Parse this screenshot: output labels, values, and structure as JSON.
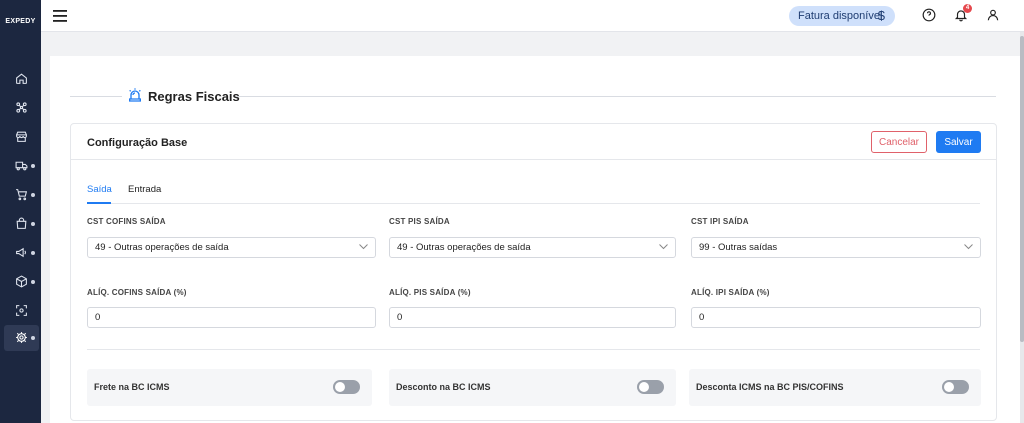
{
  "app": {
    "logo": "EXPEDY"
  },
  "sidebar": {
    "items": [
      {
        "name": "home",
        "icon": "home-icon",
        "has_dot": false
      },
      {
        "name": "integrations",
        "icon": "network-icon",
        "has_dot": false
      },
      {
        "name": "store",
        "icon": "store-icon",
        "has_dot": false
      },
      {
        "name": "shipping",
        "icon": "truck-icon",
        "has_dot": true
      },
      {
        "name": "cart",
        "icon": "cart-icon",
        "has_dot": true
      },
      {
        "name": "bag",
        "icon": "bag-icon",
        "has_dot": true
      },
      {
        "name": "marketing",
        "icon": "megaphone-icon",
        "has_dot": true
      },
      {
        "name": "products",
        "icon": "box-icon",
        "has_dot": true
      },
      {
        "name": "scan",
        "icon": "scan-icon",
        "has_dot": false
      },
      {
        "name": "settings",
        "icon": "gear-icon",
        "has_dot": true,
        "active": true
      }
    ]
  },
  "topbar": {
    "fatura_label": "Fatura disponível",
    "fatura_symbol": "$",
    "notification_count": "4"
  },
  "page": {
    "title": "Regras Fiscais"
  },
  "card": {
    "title": "Configuração Base",
    "cancel_label": "Cancelar",
    "save_label": "Salvar",
    "tabs": [
      {
        "label": "Saída",
        "active": true
      },
      {
        "label": "Entrada",
        "active": false
      }
    ],
    "selects": [
      {
        "label": "CST COFINS SAÍDA",
        "value": "49 - Outras operações de saída"
      },
      {
        "label": "CST PIS SAÍDA",
        "value": "49 - Outras operações de saída"
      },
      {
        "label": "CST IPI SAÍDA",
        "value": "99 - Outras saídas"
      }
    ],
    "inputs": [
      {
        "label": "ALÍQ. COFINS SAÍDA (%)",
        "value": "0"
      },
      {
        "label": "ALÍQ. PIS SAÍDA (%)",
        "value": "0"
      },
      {
        "label": "ALÍQ. IPI SAÍDA (%)",
        "value": "0"
      }
    ],
    "toggles": [
      {
        "label": "Frete na BC ICMS",
        "on": false
      },
      {
        "label": "Desconto na BC ICMS",
        "on": false
      },
      {
        "label": "Desconta ICMS na BC PIS/COFINS",
        "on": false
      }
    ]
  },
  "colors": {
    "sidebar_bg": "#1c2740",
    "primary": "#1f7bf2",
    "danger": "#e0616a",
    "badge": "#e5484d",
    "fatura_bg": "#cfe0fb"
  }
}
